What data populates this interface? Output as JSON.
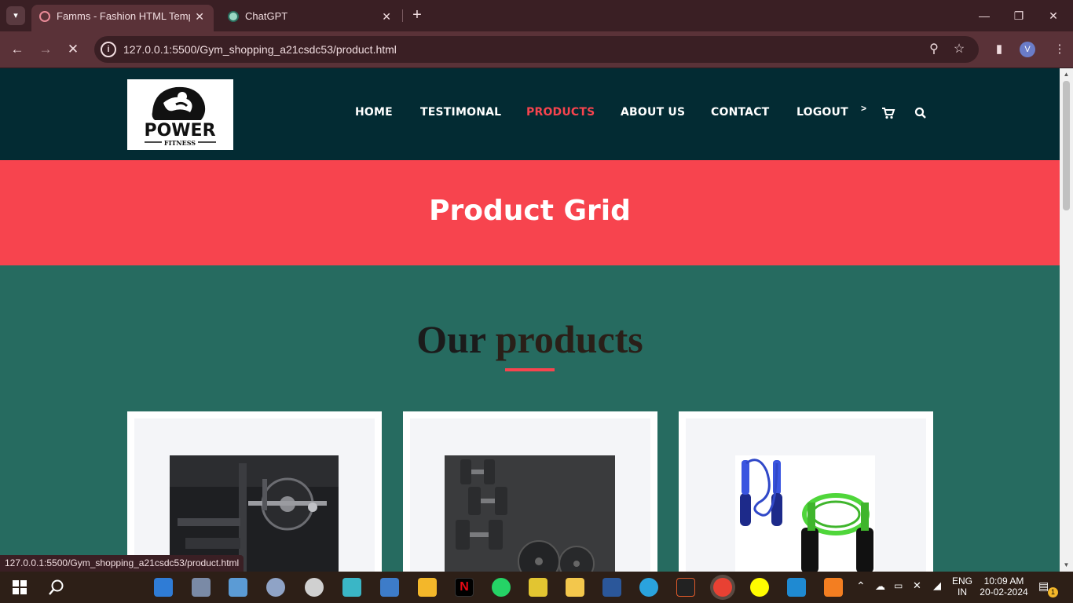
{
  "browser": {
    "tabs": [
      {
        "title": "Famms - Fashion HTML Templat",
        "active": true
      },
      {
        "title": "ChatGPT",
        "active": false
      }
    ],
    "url": "127.0.0.1:5500/Gym_shopping_a21csdc53/product.html",
    "profile_initial": "V",
    "status_url": "127.0.0.1:5500/Gym_shopping_a21csdc53/product.html"
  },
  "site": {
    "logo": {
      "line1": "POWER",
      "line2": "FITNESS"
    },
    "nav": [
      {
        "label": "HOME",
        "active": false
      },
      {
        "label": "TESTIMONAL",
        "active": false
      },
      {
        "label": "PRODUCTS",
        "active": true
      },
      {
        "label": "ABOUT US",
        "active": false
      },
      {
        "label": "CONTACT",
        "active": false
      },
      {
        "label": "LOGOUT",
        "active": false
      }
    ],
    "nav_chevron": ">",
    "hero_title": "Product Grid",
    "section_heading": {
      "word1": "Our",
      "word2": "products"
    },
    "products": [
      {
        "image": "gym-weight-plate-rack-photo"
      },
      {
        "image": "dumbbells-on-mat-photo"
      },
      {
        "image": "skipping-ropes-photo"
      }
    ],
    "colors": {
      "header": "#032b33",
      "accent": "#f7444e",
      "page_bg": "#266b60"
    }
  },
  "taskbar": {
    "language": {
      "line1": "ENG",
      "line2": "IN"
    },
    "time": "10:09 AM",
    "date": "20-02-2024",
    "notification_count": "1"
  }
}
